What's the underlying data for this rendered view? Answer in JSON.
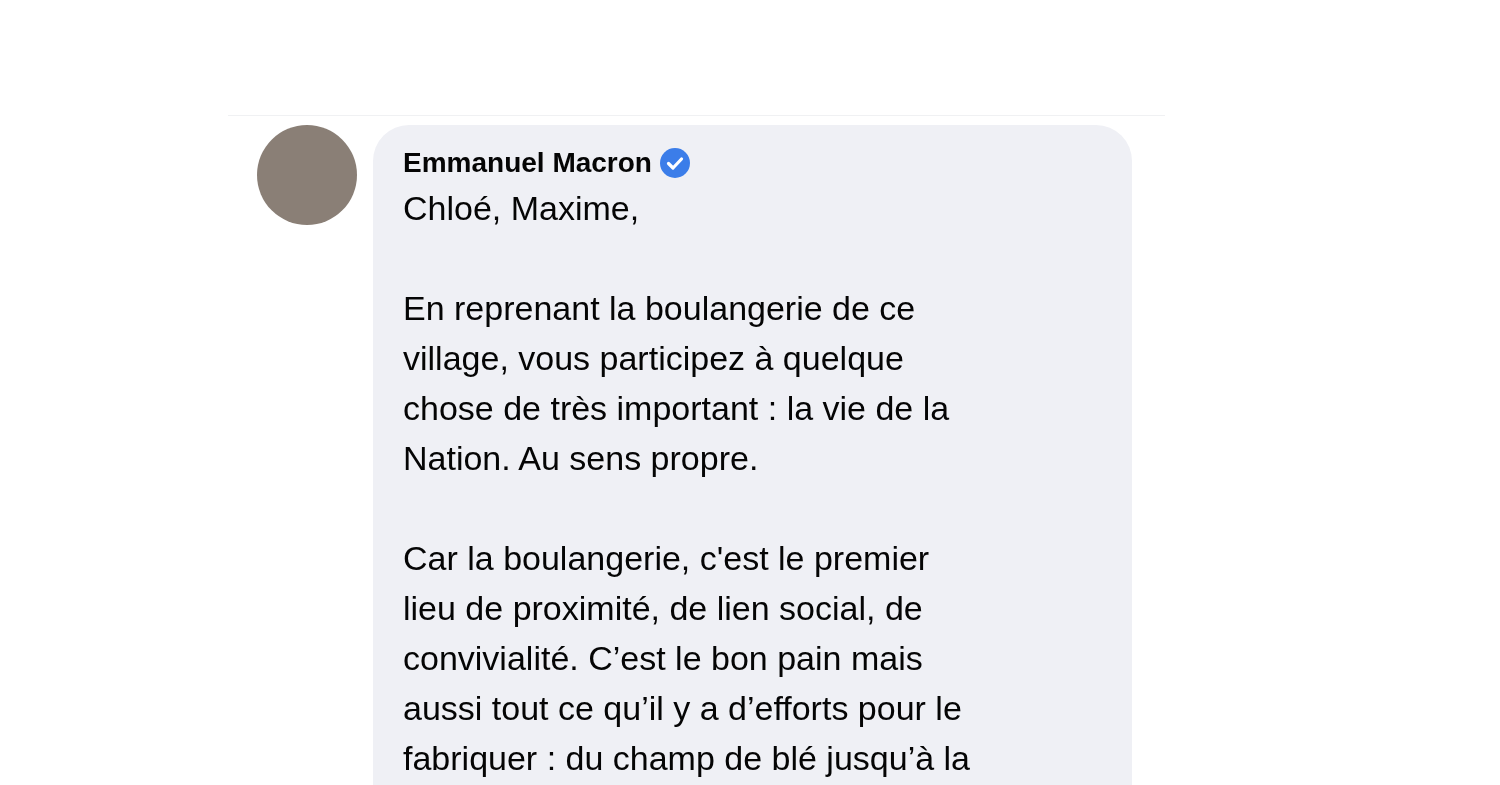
{
  "comment": {
    "author": "Emmanuel Macron",
    "verified": true,
    "paragraphs": [
      [
        "Chloé, Maxime,"
      ],
      [
        "En reprenant la boulangerie de ce",
        "village, vous participez à quelque",
        "chose de très important : la vie de la",
        "Nation. Au sens propre."
      ],
      [
        "Car la boulangerie, c'est le premier",
        "lieu de proximité, de lien social, de",
        "convivialité. C’est le bon pain mais",
        "aussi tout ce qu’il y a d’efforts pour le",
        "fabriquer : du champ de blé jusqu’à la"
      ]
    ]
  }
}
